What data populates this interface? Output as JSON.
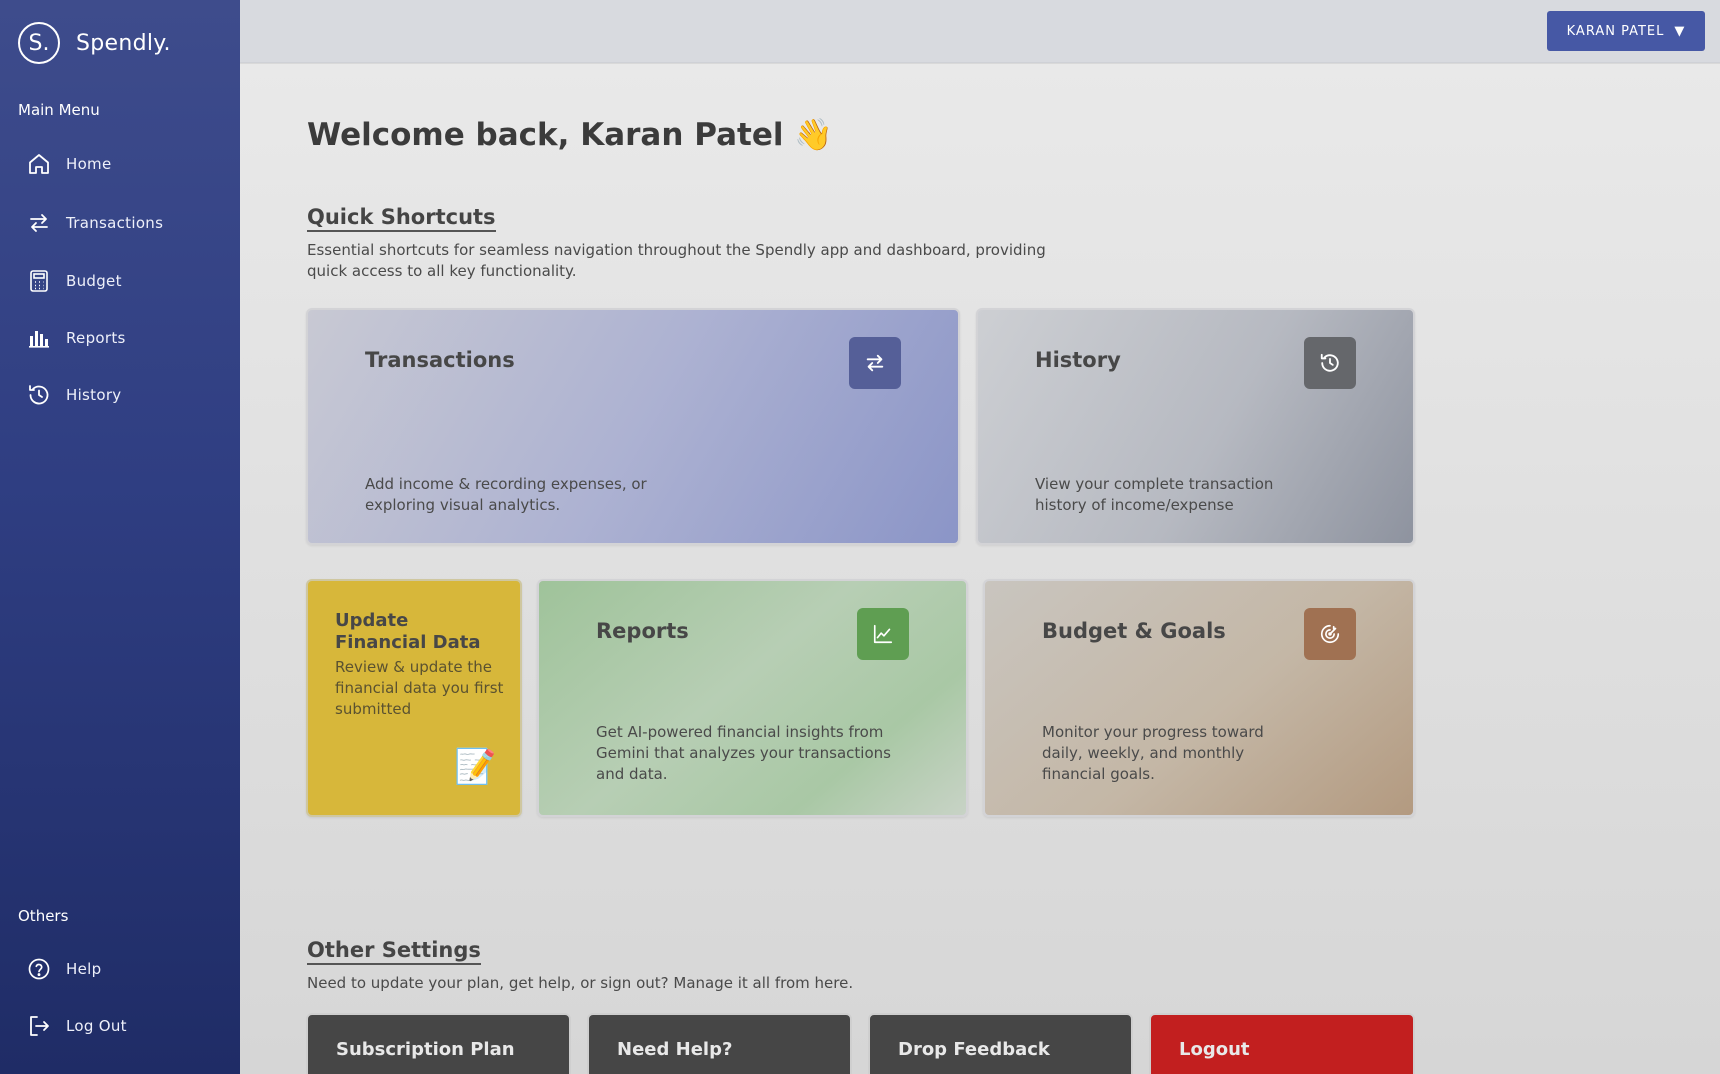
{
  "app": {
    "logo_letter": "S.",
    "name": "Spendly."
  },
  "sidebar": {
    "main_menu_label": "Main Menu",
    "items": [
      {
        "label": "Home",
        "icon": "home-icon"
      },
      {
        "label": "Transactions",
        "icon": "swap-arrows-icon"
      },
      {
        "label": "Budget",
        "icon": "calculator-icon"
      },
      {
        "label": "Reports",
        "icon": "bar-chart-icon"
      },
      {
        "label": "History",
        "icon": "history-icon"
      }
    ],
    "others_label": "Others",
    "others": [
      {
        "label": "Help",
        "icon": "help-circle-icon"
      },
      {
        "label": "Log Out",
        "icon": "logout-icon"
      }
    ]
  },
  "topbar": {
    "user_label": "KARAN PATEL",
    "caret": "▼"
  },
  "main": {
    "welcome": "Welcome back, Karan Patel 👋",
    "quick": {
      "title": "Quick Shortcuts",
      "desc": "Essential shortcuts for seamless navigation throughout the Spendly app and dashboard, providing quick access to all key functionality."
    },
    "cards": {
      "transactions": {
        "title": "Transactions",
        "desc": "Add income & recording expenses, or exploring visual analytics.",
        "icon": "swap-arrows-icon",
        "icon_color": "#555f98"
      },
      "history": {
        "title": "History",
        "desc": "View your complete transaction history of income/expense",
        "icon": "history-icon",
        "icon_color": "#65676b"
      },
      "update": {
        "title": "Update Financial Data",
        "desc": "Review & update the financial data you first submitted",
        "emoji": "📝",
        "color": "#d7b73a"
      },
      "reports": {
        "title": "Reports",
        "desc": "Get AI-powered financial insights from Gemini that analyzes your transactions and data.",
        "icon": "line-chart-icon",
        "icon_color": "#5f9e52"
      },
      "budget": {
        "title": "Budget & Goals",
        "desc": "Monitor your progress toward daily, weekly, and monthly financial goals.",
        "icon": "target-icon",
        "icon_color": "#a07152"
      }
    },
    "other": {
      "title": "Other Settings",
      "desc": "Need to update your plan, get help, or sign out? Manage it all from here.",
      "items": [
        "Subscription Plan",
        "Need Help?",
        "Drop Feedback",
        "Logout"
      ]
    }
  }
}
